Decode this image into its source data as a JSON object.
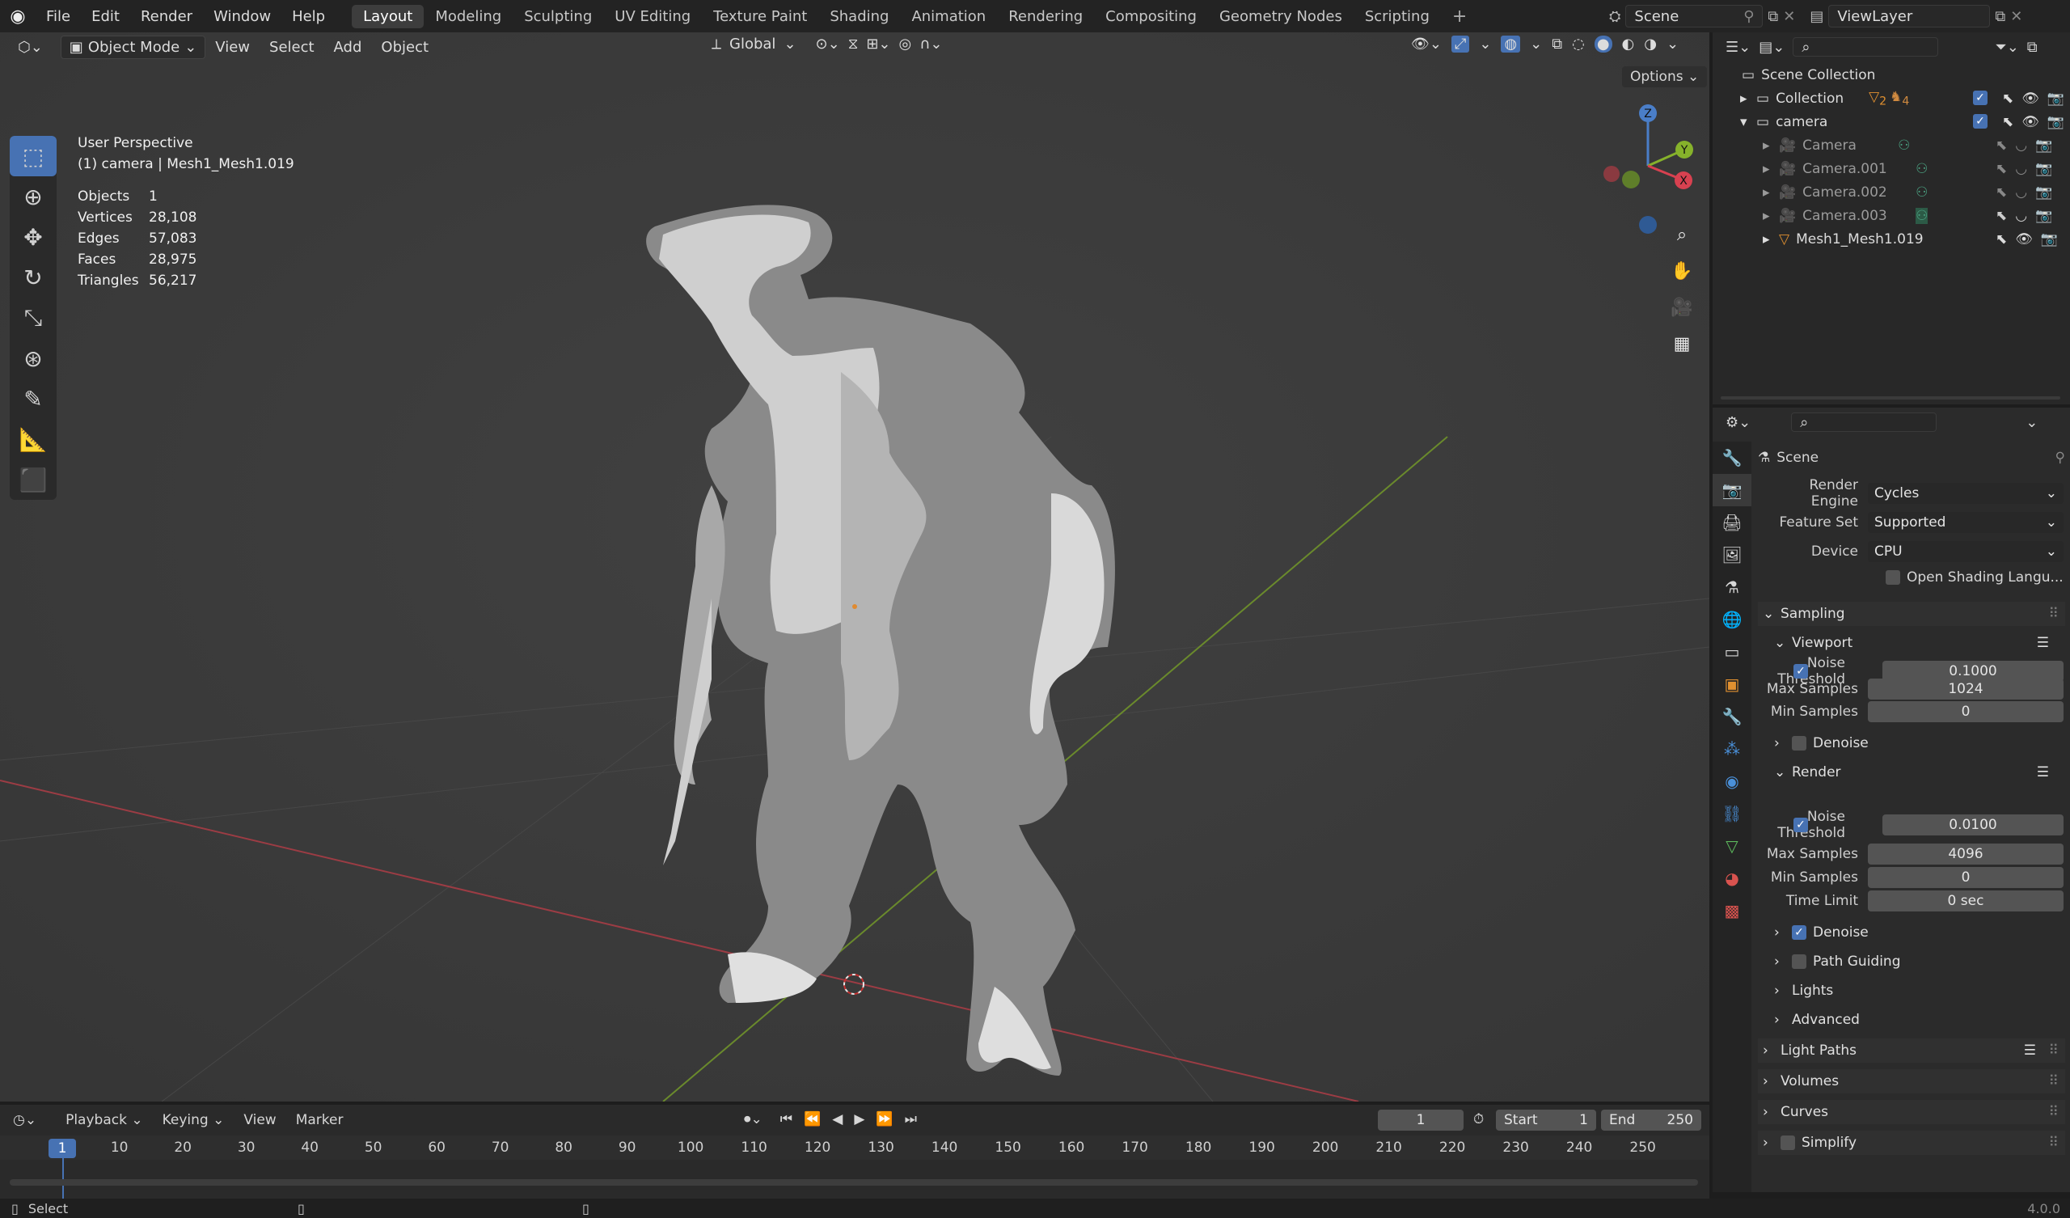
{
  "menu": [
    "File",
    "Edit",
    "Render",
    "Window",
    "Help"
  ],
  "workspaces": [
    "Layout",
    "Modeling",
    "Sculpting",
    "UV Editing",
    "Texture Paint",
    "Shading",
    "Animation",
    "Rendering",
    "Compositing",
    "Geometry Nodes",
    "Scripting"
  ],
  "active_workspace": "Layout",
  "scene_name": "Scene",
  "view_layer": "ViewLayer",
  "viewport": {
    "mode": "Object Mode",
    "menus": [
      "View",
      "Select",
      "Add",
      "Object"
    ],
    "orientation": "Global",
    "options_label": "Options",
    "view_name": "User Perspective",
    "active": "(1) camera | Mesh1_Mesh1.019",
    "stats": [
      {
        "k": "Objects",
        "v": "1"
      },
      {
        "k": "Vertices",
        "v": "28,108"
      },
      {
        "k": "Edges",
        "v": "57,083"
      },
      {
        "k": "Faces",
        "v": "28,975"
      },
      {
        "k": "Triangles",
        "v": "56,217"
      }
    ],
    "gizmo": {
      "z": "Z",
      "y": "Y",
      "x": "X"
    }
  },
  "outliner": {
    "root": "Scene Collection",
    "items": [
      {
        "name": "Collection",
        "indent": 1,
        "expanded": false
      },
      {
        "name": "camera",
        "indent": 1,
        "expanded": true
      },
      {
        "name": "Camera",
        "indent": 2
      },
      {
        "name": "Camera.001",
        "indent": 2
      },
      {
        "name": "Camera.002",
        "indent": 2
      },
      {
        "name": "Camera.003",
        "indent": 2
      },
      {
        "name": "Mesh1_Mesh1.019",
        "indent": 2
      }
    ],
    "collection_badges": [
      "2",
      "4"
    ]
  },
  "properties": {
    "context": "Scene",
    "render_engine_label": "Render Engine",
    "render_engine": "Cycles",
    "feature_set_label": "Feature Set",
    "feature_set": "Supported",
    "device_label": "Device",
    "device": "CPU",
    "osl_label": "Open Shading Langu...",
    "sampling": "Sampling",
    "viewport_label": "Viewport",
    "noise_threshold_label": "Noise Threshold",
    "vp_noise": "0.1000",
    "max_samples_label": "Max Samples",
    "vp_max": "1024",
    "min_samples_label": "Min Samples",
    "vp_min": "0",
    "denoise_label": "Denoise",
    "render_label": "Render",
    "r_noise": "0.0100",
    "r_max": "4096",
    "r_min": "0",
    "time_limit_label": "Time Limit",
    "time_limit": "0 sec",
    "path_guiding": "Path Guiding",
    "lights": "Lights",
    "advanced": "Advanced",
    "light_paths": "Light Paths",
    "volumes": "Volumes",
    "curves": "Curves",
    "simplify": "Simplify"
  },
  "timeline": {
    "menus": [
      "Playback",
      "Keying",
      "View",
      "Marker"
    ],
    "current_frame": "1",
    "start_label": "Start",
    "start": "1",
    "end_label": "End",
    "end": "250",
    "ticks": [
      "1",
      "10",
      "20",
      "30",
      "40",
      "50",
      "60",
      "70",
      "80",
      "90",
      "100",
      "110",
      "120",
      "130",
      "140",
      "150",
      "160",
      "170",
      "180",
      "190",
      "200",
      "210",
      "220",
      "230",
      "240",
      "250"
    ]
  },
  "status": {
    "select": "Select",
    "version": "4.0.0"
  }
}
